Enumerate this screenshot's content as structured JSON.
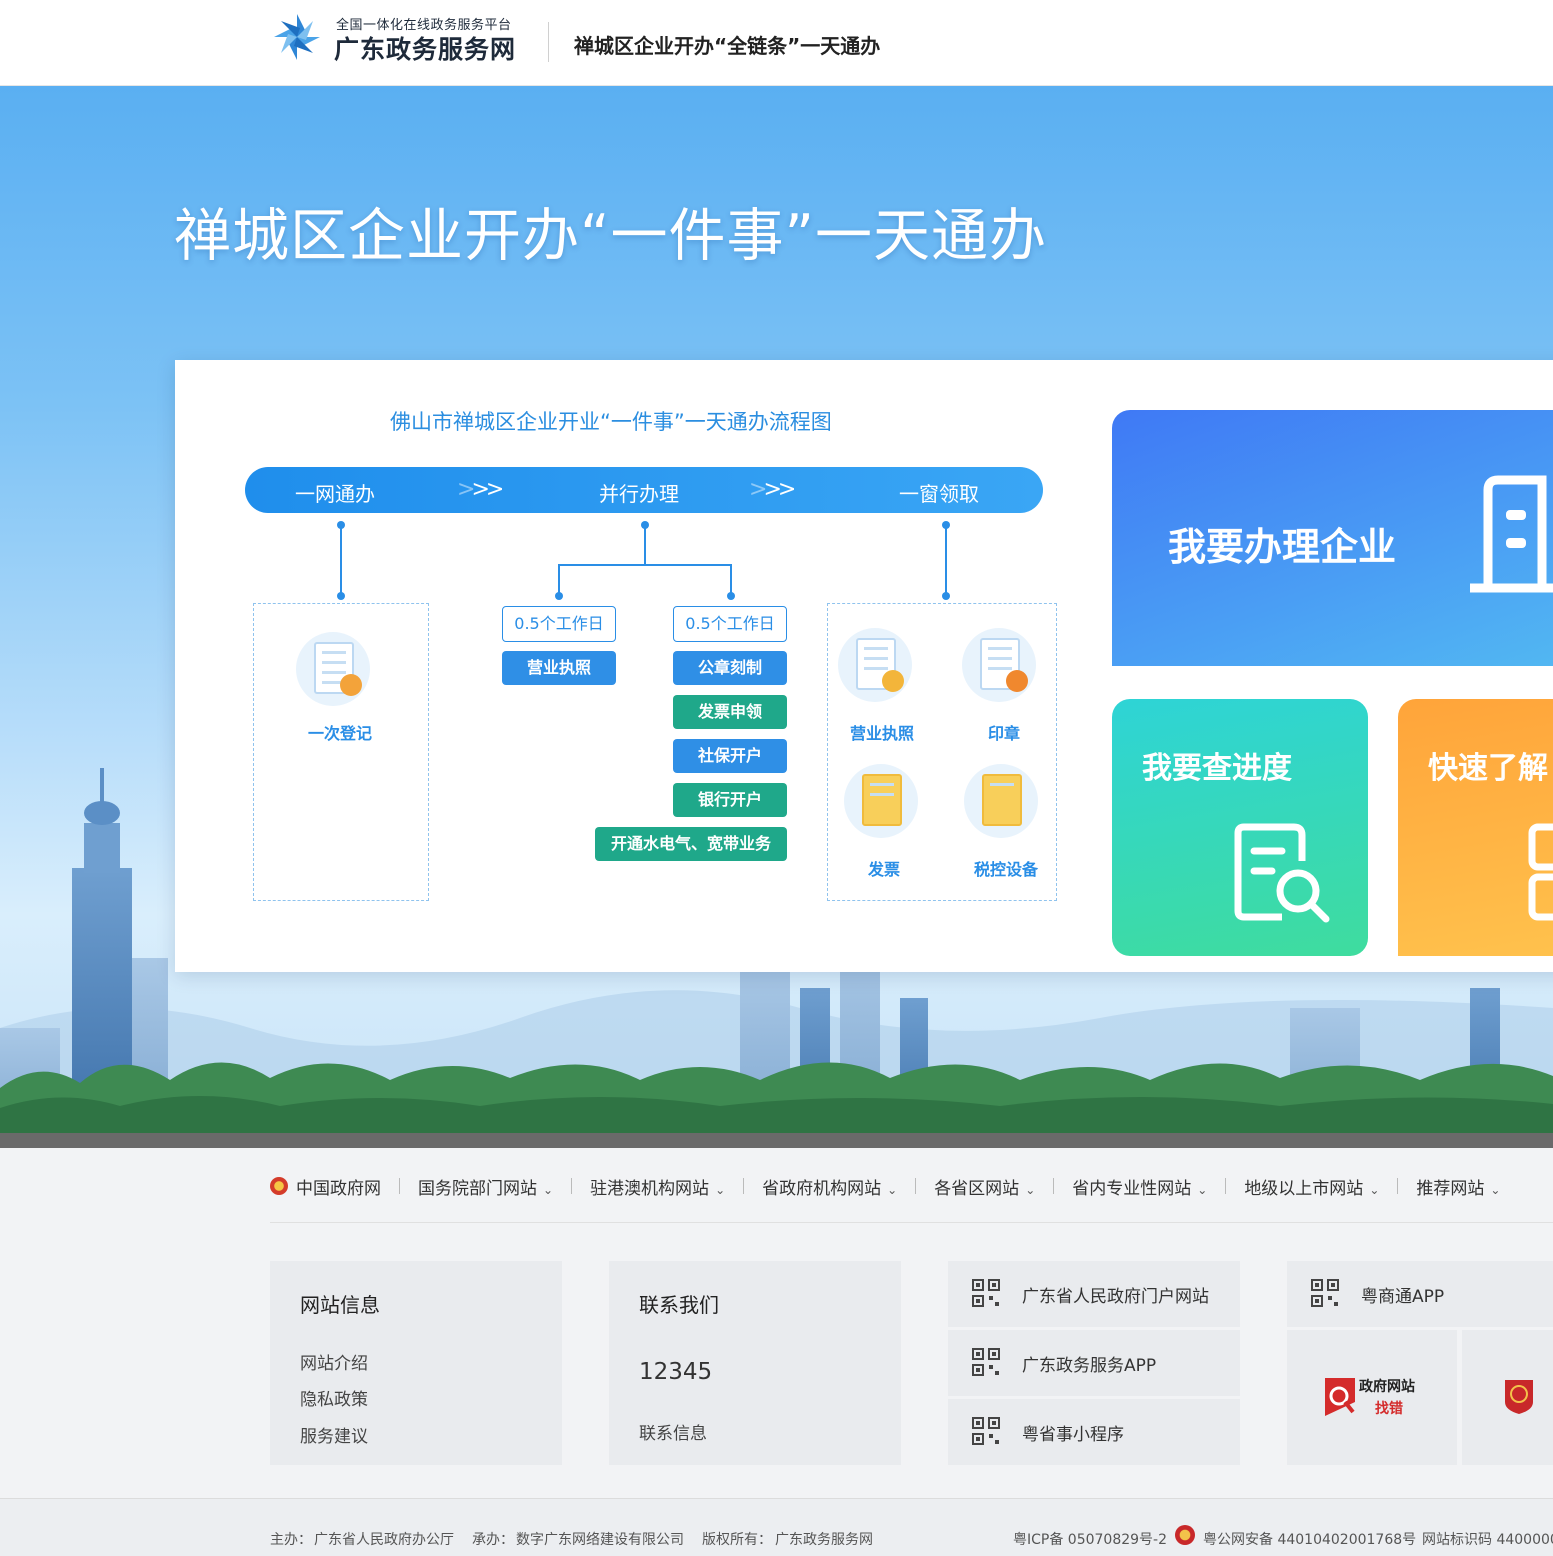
{
  "header": {
    "logo_sub": "全国一体化在线政务服务平台",
    "logo_main": "广东政务服务网",
    "page_title": "禅城区企业开办“全链条”一天通办"
  },
  "hero": {
    "title": "禅城区企业开办“一件事”一天通办"
  },
  "flow": {
    "title": "佛山市禅城区企业开业“一件事”一天通办流程图",
    "stages": [
      "一网通办",
      "并行办理",
      "一窗领取"
    ],
    "step1_label": "一次登记",
    "time_a": "0.5个工作日",
    "time_b": "0.5个工作日",
    "col_a": [
      "营业执照"
    ],
    "col_b": [
      "公章刻制",
      "发票申领",
      "社保开户",
      "银行开户"
    ],
    "col_b_wide": "开通水电气、宽带业务",
    "pickup": [
      "营业执照",
      "印章",
      "发票",
      "税控设备"
    ]
  },
  "cards": {
    "card1": "我要办理企业",
    "card2": "我要查进度",
    "card3": "快速了解"
  },
  "footer": {
    "links": [
      {
        "label": "中国政府网",
        "dropdown": false
      },
      {
        "label": "国务院部门网站",
        "dropdown": true
      },
      {
        "label": "驻港澳机构网站",
        "dropdown": true
      },
      {
        "label": "省政府机构网站",
        "dropdown": true
      },
      {
        "label": "各省区网站",
        "dropdown": true
      },
      {
        "label": "省内专业性网站",
        "dropdown": true
      },
      {
        "label": "地级以上市网站",
        "dropdown": true
      },
      {
        "label": "推荐网站",
        "dropdown": true
      }
    ],
    "site_info": {
      "title": "网站信息",
      "items": [
        "网站介绍",
        "隐私政策",
        "服务建议"
      ]
    },
    "contact": {
      "title": "联系我们",
      "phone": "12345",
      "info": "联系信息"
    },
    "qr_links": [
      "广东省人民政府门户网站",
      "广东政务服务APP",
      "粤省事小程序",
      "粤商通APP"
    ],
    "badge_find_error": {
      "line1": "政府网站",
      "line2": "找错"
    },
    "bottom": {
      "host_label": "主办：",
      "host": "广东省人民政府办公厅",
      "undertake_label": "承办：",
      "undertake": "数字广东网络建设有限公司",
      "copyright_label": "版权所有：",
      "copyright": "广东政务服务网",
      "icp": "粤ICP备 05070829号-2",
      "police": "粤公网安备 44010402001768号",
      "site_code": "网站标识码 4400000"
    }
  },
  "colors": {
    "brand_blue": "#2a8ee6",
    "chip_green": "#1fa88a",
    "card_blue": "#3f79f5",
    "card_green": "#3fdc9e",
    "card_orange": "#ffa43a"
  }
}
